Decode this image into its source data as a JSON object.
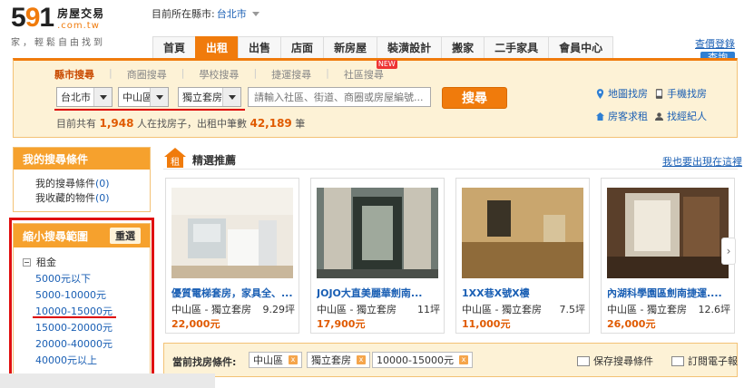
{
  "logo": {
    "num_5": "5",
    "num_9": "9",
    "num_1": "1",
    "title": "房屋交易",
    "domain": ".com.tw",
    "slogan": "家，輕鬆自由找到"
  },
  "location": {
    "label": "目前所在縣市:",
    "city": "台北市"
  },
  "nav": {
    "items": [
      "首頁",
      "出租",
      "出售",
      "店面",
      "新房屋",
      "裝潢設計",
      "搬家",
      "二手家具",
      "會員中心"
    ],
    "active": 1
  },
  "topright": {
    "lang": "查價登錄",
    "login": "查詢"
  },
  "search": {
    "tabs": [
      "縣市搜尋",
      "商圈搜尋",
      "學校搜尋",
      "捷運搜尋",
      "社區搜尋"
    ],
    "new_badge": "NEW",
    "city": "台北市",
    "district": "中山區",
    "type": "獨立套房",
    "placeholder": "請輸入社區、街道、商圈或房屋編號...",
    "button": "搜尋",
    "stats_prefix": "目前共有",
    "stats_people": "1,948",
    "stats_mid": "人在找房子，出租中筆數",
    "stats_count": "42,189",
    "stats_suffix": "筆"
  },
  "side_links": {
    "map": "地圖找房",
    "phone": "手機找房",
    "agent": "房客求租",
    "broker": "找經紀人"
  },
  "panel_conditions": {
    "title": "我的搜尋條件",
    "saved_label": "我的搜尋條件",
    "saved_count": "(0)",
    "fav_label": "我收藏的物件",
    "fav_count": "(0)"
  },
  "panel_filter": {
    "title": "縮小搜尋範圍",
    "reset": "重選",
    "rent_label": "租金",
    "ranges": [
      "5000元以下",
      "5000-10000元",
      "10000-15000元",
      "15000-20000元",
      "20000-40000元",
      "40000元以上"
    ]
  },
  "featured": {
    "icon_text": "租",
    "title": "精選推薦",
    "link": "我也要出現在這裡",
    "cards": [
      {
        "title": "優質電梯套房，家具全、...",
        "area": "中山區 - 獨立套房",
        "size": "9.29坪",
        "price": "22,000元"
      },
      {
        "title": "JOJO大直美麗華劍南...",
        "area": "中山區 - 獨立套房",
        "size": "11坪",
        "price": "17,900元"
      },
      {
        "title": "1XX巷X號X樓",
        "area": "中山區 - 獨立套房",
        "size": "7.5坪",
        "price": "11,000元"
      },
      {
        "title": "內湖科學園區劍南捷運....",
        "area": "中山區 - 獨立套房",
        "size": "12.6坪",
        "price": "26,000元"
      }
    ]
  },
  "current": {
    "label": "當前找房條件:",
    "chips": [
      "中山區",
      "獨立套房",
      "10000-15000元"
    ],
    "chip_close": "x",
    "save": "保存搜尋條件",
    "subscribe": "訂閱電子報"
  },
  "colors": {
    "accent": "#f07b0c",
    "link": "#1a5fb4",
    "highlight": "#e01010"
  }
}
